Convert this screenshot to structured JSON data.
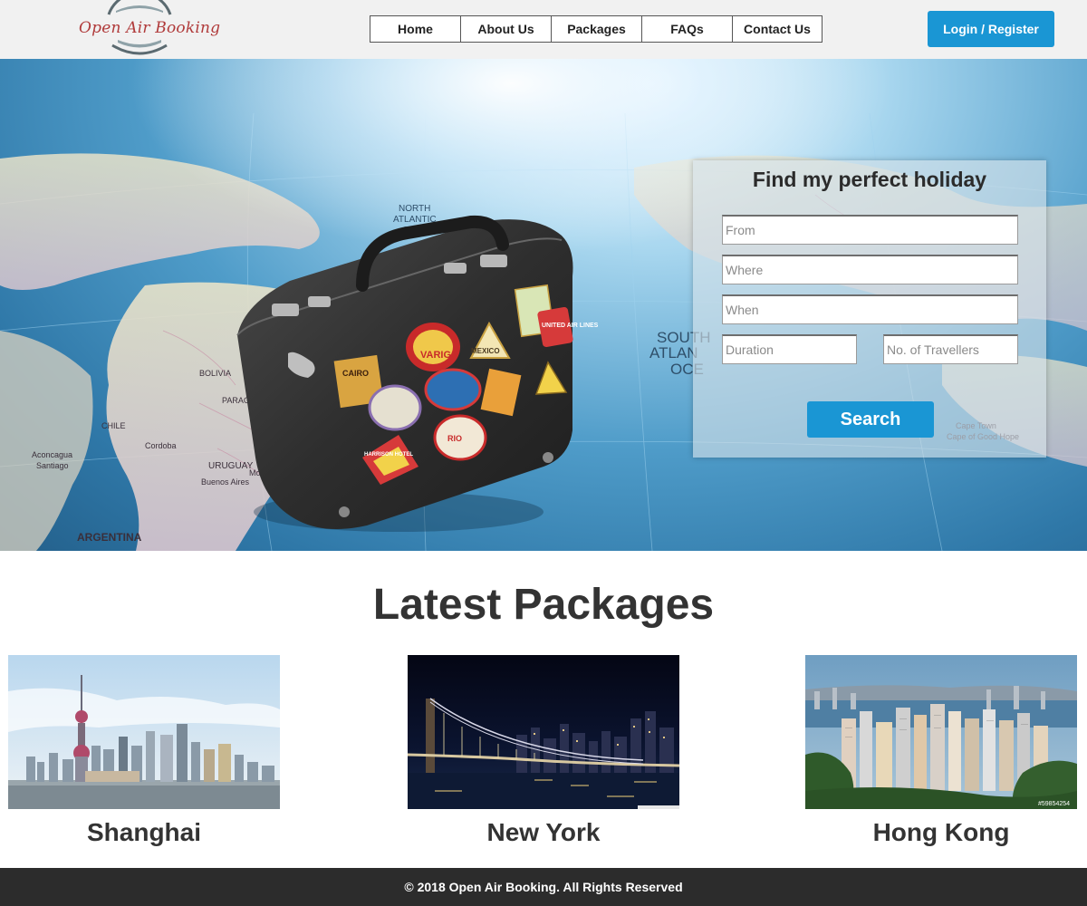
{
  "brand": {
    "name": "Open Air Booking",
    "colors": {
      "primary": "#1a96d4",
      "header_bg": "#f1f1f1",
      "footer_bg": "#2c2c2c",
      "logo_text": "#b03a3a"
    }
  },
  "nav": {
    "items": [
      {
        "label": "Home"
      },
      {
        "label": "About Us"
      },
      {
        "label": "Packages"
      },
      {
        "label": "FAQs"
      },
      {
        "label": "Contact Us"
      }
    ]
  },
  "header": {
    "login_label": "Login / Register"
  },
  "hero": {
    "map_labels": [
      "NORTH ATLANTIC OCEAN",
      "SOUTH ATLANTIC OCEAN",
      "ARGENTINA",
      "BOLIVIA",
      "PARAGUAY",
      "CHILE",
      "URUGUAY",
      "Montevideo",
      "Buenos Aires",
      "Cordoba",
      "Aconcagua",
      "Santiago",
      "Cape Town",
      "Cape of Good Hope"
    ],
    "suitcase_stickers": [
      "CAIRO",
      "VARIG",
      "MEXICO",
      "UNITED AIR LINES",
      "RIO",
      "HARRISON HOTEL"
    ]
  },
  "search": {
    "title": "Find my perfect holiday",
    "from_placeholder": "From",
    "where_placeholder": "Where",
    "when_placeholder": "When",
    "duration_placeholder": "Duration",
    "travellers_placeholder": "No. of Travellers",
    "button_label": "Search"
  },
  "packages": {
    "title": "Latest Packages",
    "items": [
      {
        "name": "Shanghai",
        "image": "shanghai-skyline"
      },
      {
        "name": "New York",
        "image": "brooklyn-bridge-night"
      },
      {
        "name": "Hong Kong",
        "image": "hong-kong-aerial",
        "watermark": "#59854254"
      }
    ]
  },
  "footer": {
    "text": "© 2018 Open Air Booking. All Rights Reserved"
  }
}
